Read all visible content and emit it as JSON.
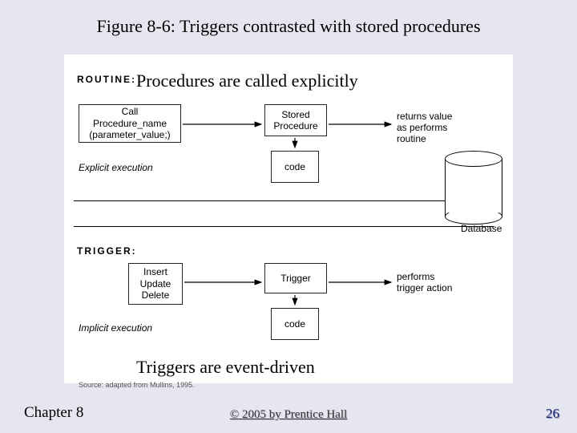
{
  "title": "Figure 8-6: Triggers contrasted with stored procedures",
  "sub_procedures": "Procedures are called explicitly",
  "sub_triggers": "Triggers are event-driven",
  "routine_label": "ROUTINE:",
  "trigger_label": "TRIGGER:",
  "call_box_l1": "Call",
  "call_box_l2": "Procedure_name",
  "call_box_l3": "(parameter_value;)",
  "stored_proc_l1": "Stored",
  "stored_proc_l2": "Procedure",
  "code_label": "code",
  "iud_l1": "Insert",
  "iud_l2": "Update",
  "iud_l3": "Delete",
  "trigger_box": "Trigger",
  "returns_l1": "returns value",
  "returns_l2": "as performs",
  "returns_l3": "routine",
  "performs_l1": "performs",
  "performs_l2": "trigger action",
  "explicit_exec": "Explicit execution",
  "implicit_exec": "Implicit execution",
  "database_label": "Database",
  "source_label": "Source: adapted from Mullins, 1995.",
  "footer_chapter": "Chapter 8",
  "footer_copyright": "© 2005 by Prentice Hall",
  "footer_page": "26"
}
